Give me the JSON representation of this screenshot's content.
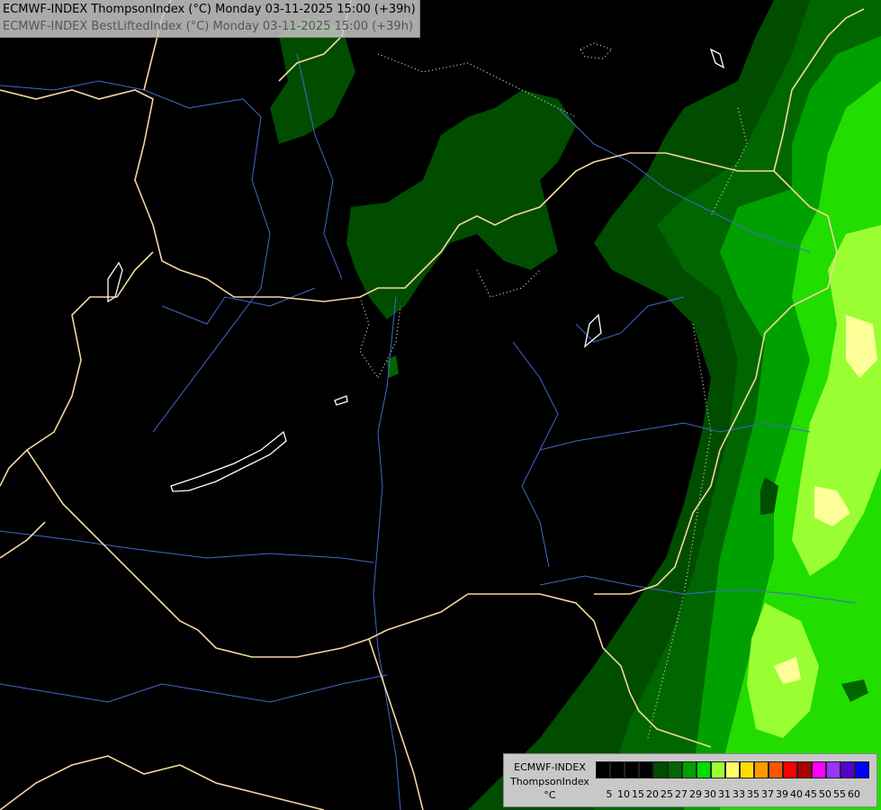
{
  "header": {
    "line1": "ECMWF-INDEX ThompsonIndex (°C) Monday 03-11-2025 15:00 (+39h)",
    "line2": "ECMWF-INDEX BestLiftedIndex (°C) Monday 03-11-2025 15:00 (+39h)"
  },
  "legend": {
    "line1": "ECMWF-INDEX",
    "line2": "ThompsonIndex",
    "line3": "°C",
    "ticks": [
      "5",
      "10",
      "15",
      "20",
      "25",
      "27",
      "29",
      "30",
      "31",
      "33",
      "35",
      "37",
      "39",
      "40",
      "45",
      "50",
      "55",
      "60"
    ],
    "colors": [
      "#000000",
      "#000000",
      "#000000",
      "#000000",
      "#004d00",
      "#006600",
      "#00a000",
      "#00dd00",
      "#99ff33",
      "#ffff66",
      "#ffdd00",
      "#ff9900",
      "#ff5500",
      "#ff0000",
      "#aa0000",
      "#ff00ff",
      "#9933ff",
      "#5500cc",
      "#0000ff"
    ]
  },
  "palette": {
    "background": "#000000",
    "border": "#f5d5a0",
    "river": "#5577dd",
    "lake": "#ffffff"
  }
}
